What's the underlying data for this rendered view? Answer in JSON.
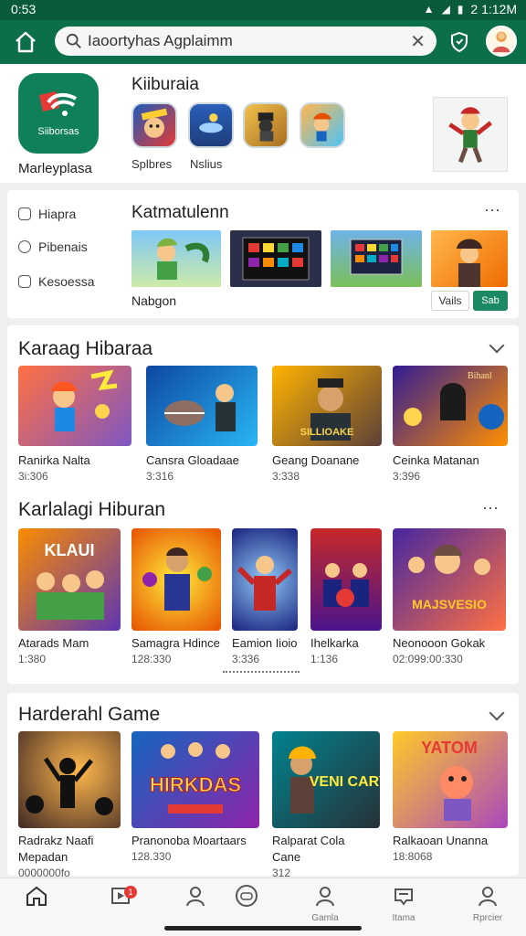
{
  "status_bar": {
    "time": "0:53",
    "clock_right": "2 1:12M",
    "icons": [
      "wifi-icon",
      "signal-icon",
      "battery-icon"
    ]
  },
  "top_bar": {
    "search_value": "Iaoortyhas Agplaimm",
    "icons": [
      "home-icon",
      "search-icon",
      "clear-icon",
      "shield-icon",
      "avatar"
    ]
  },
  "store": {
    "logo_text": "Siiborsas",
    "label": "Marleyplasa",
    "section_title": "Kiiburaia",
    "mini_labels": [
      "Splbres",
      "Nslius"
    ]
  },
  "promo": {
    "menu": [
      "Hiapra",
      "Pibenais",
      "Kesoessa"
    ],
    "title": "Katmatulenn",
    "subtitle": "Nabgon",
    "view_button": "Vails",
    "go_button": "Sab"
  },
  "sections": {
    "s1": {
      "title": "Karaag Hibaraa",
      "items": [
        {
          "name": "Ranirka Nalta",
          "meta": "3i:306"
        },
        {
          "name": "Cansra Gloadaae",
          "meta": "3:316"
        },
        {
          "name": "Geang Doanane",
          "meta": "3:338"
        },
        {
          "name": "Ceinka Matanan",
          "meta": "3:396"
        }
      ]
    },
    "s2": {
      "title": "Karlalagi Hiburan",
      "items": [
        {
          "name": "Atarads Mam",
          "meta": "1:380"
        },
        {
          "name": "Samagra Hdince",
          "meta": "128:330"
        },
        {
          "name": "Eamion Iioio",
          "meta": "3:336"
        },
        {
          "name": "Ihelkarka",
          "meta": "1:136"
        },
        {
          "name": "Neonooon Gokak",
          "meta": "02:099:00:330"
        }
      ]
    },
    "s3": {
      "title": "Harderahl Game",
      "items": [
        {
          "name": "Radrakz Naafi",
          "name2": "Mepadan",
          "meta": "0000000fo"
        },
        {
          "name": "Pranonoba Moartaars",
          "meta": "128.330"
        },
        {
          "name": "Ralparat Cola",
          "name2": "Cane",
          "meta": "312"
        },
        {
          "name": "Ralkaoan Unanna",
          "meta": "18:8068"
        }
      ]
    }
  },
  "art_text": {
    "a1": "SILLIOAKE",
    "a2": "KLAUI",
    "a3": "Bihanl",
    "a4": "MAJSVESIO",
    "a5": "HIRKDAS",
    "a6": "VENI CARY",
    "a7": "YATOM"
  },
  "bottom_nav": {
    "badge": "1",
    "labels": [
      "",
      "",
      "",
      "",
      "Gamla",
      "Itama",
      "Rprcier"
    ]
  },
  "colors": {
    "brand": "#0d6e4a",
    "accent": "#1b8a63",
    "badge": "#e53935"
  }
}
